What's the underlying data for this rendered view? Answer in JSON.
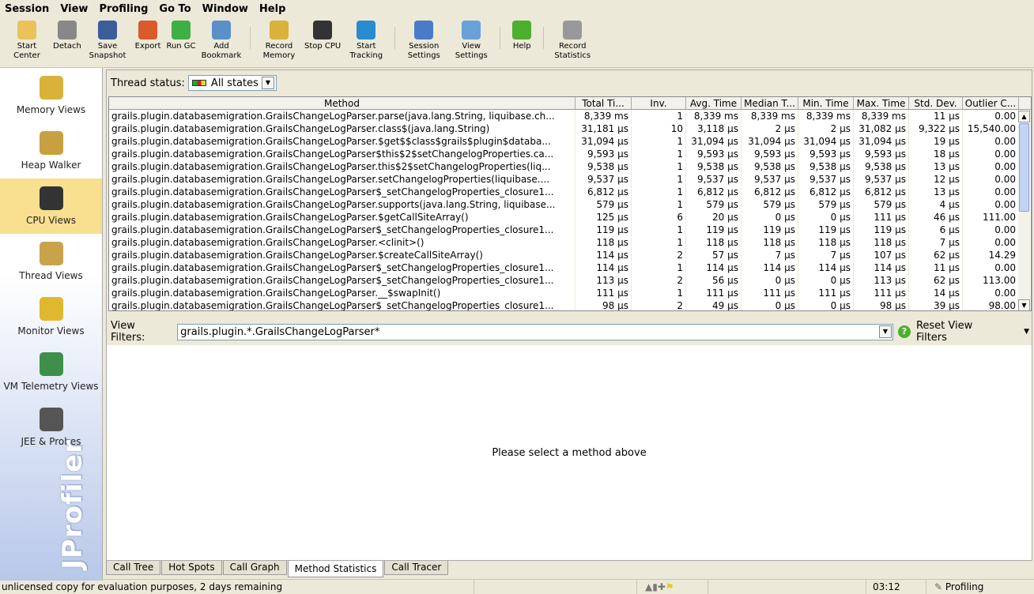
{
  "menu": [
    "Session",
    "View",
    "Profiling",
    "Go To",
    "Window",
    "Help"
  ],
  "toolbar": [
    {
      "label": "Start Center",
      "icon": "folder-gear-icon",
      "color": "#e9c25a"
    },
    {
      "label": "Detach",
      "icon": "detach-plug-icon",
      "color": "#888"
    },
    {
      "label": "Save Snapshot",
      "icon": "floppy-disk-icon",
      "color": "#3a5e9a"
    },
    {
      "label": "Export",
      "icon": "export-arrow-icon",
      "color": "#d95a2b"
    },
    {
      "label": "Run GC",
      "icon": "recycle-icon",
      "color": "#3cb043"
    },
    {
      "label": "Add Bookmark",
      "icon": "bookmark-add-icon",
      "color": "#5b8fc9"
    },
    {
      "label": "Record Memory",
      "icon": "record-memory-icon",
      "color": "#d8b23a"
    },
    {
      "label": "Stop CPU",
      "icon": "stop-cpu-icon",
      "color": "#333"
    },
    {
      "label": "Start Tracking",
      "icon": "start-tracking-icon",
      "color": "#2a8bd0"
    },
    {
      "label": "Session Settings",
      "icon": "clipboard-settings-icon",
      "color": "#4a7bc8"
    },
    {
      "label": "View Settings",
      "icon": "view-settings-icon",
      "color": "#6aa0d8"
    },
    {
      "label": "Help",
      "icon": "help-icon",
      "color": "#4caf2e"
    },
    {
      "label": "Record Statistics",
      "icon": "stopwatch-record-icon",
      "color": "#999"
    }
  ],
  "sidebar": [
    {
      "label": "Memory Views",
      "icon": "memory-blocks-icon",
      "color": "#d8b23a"
    },
    {
      "label": "Heap Walker",
      "icon": "heap-walker-icon",
      "color": "#c8a040"
    },
    {
      "label": "CPU Views",
      "icon": "cpu-chip-icon",
      "color": "#333",
      "selected": true
    },
    {
      "label": "Thread Views",
      "icon": "thread-spool-icon",
      "color": "#c9a34a"
    },
    {
      "label": "Monitor Views",
      "icon": "padlock-icon",
      "color": "#e0b830"
    },
    {
      "label": "VM Telemetry Views",
      "icon": "telemetry-chart-icon",
      "color": "#3d8f4a"
    },
    {
      "label": "JEE & Probes",
      "icon": "probe-gauge-icon",
      "color": "#555"
    }
  ],
  "brand": "JProfiler",
  "thread_status": {
    "label": "Thread status:",
    "value": "All states"
  },
  "table": {
    "columns": [
      "Method",
      "Total Ti...",
      "Inv.",
      "Avg. Time",
      "Median T...",
      "Min. Time",
      "Max. Time",
      "Std. Dev.",
      "Outlier C..."
    ],
    "rows": [
      [
        "grails.plugin.databasemigration.GrailsChangeLogParser.parse(java.lang.String, liquibase.ch...",
        "8,339 ms",
        "1",
        "8,339 ms",
        "8,339 ms",
        "8,339 ms",
        "8,339 ms",
        "11 µs",
        "0.00"
      ],
      [
        "grails.plugin.databasemigration.GrailsChangeLogParser.class$(java.lang.String)",
        "31,181 µs",
        "10",
        "3,118 µs",
        "2 µs",
        "2 µs",
        "31,082 µs",
        "9,322 µs",
        "15,540.00"
      ],
      [
        "grails.plugin.databasemigration.GrailsChangeLogParser.$get$$class$grails$plugin$databa...",
        "31,094 µs",
        "1",
        "31,094 µs",
        "31,094 µs",
        "31,094 µs",
        "31,094 µs",
        "19 µs",
        "0.00"
      ],
      [
        "grails.plugin.databasemigration.GrailsChangeLogParser$this$2$setChangelogProperties.ca...",
        "9,593 µs",
        "1",
        "9,593 µs",
        "9,593 µs",
        "9,593 µs",
        "9,593 µs",
        "18 µs",
        "0.00"
      ],
      [
        "grails.plugin.databasemigration.GrailsChangeLogParser.this$2$setChangelogProperties(liq...",
        "9,538 µs",
        "1",
        "9,538 µs",
        "9,538 µs",
        "9,538 µs",
        "9,538 µs",
        "13 µs",
        "0.00"
      ],
      [
        "grails.plugin.databasemigration.GrailsChangeLogParser.setChangelogProperties(liquibase....",
        "9,537 µs",
        "1",
        "9,537 µs",
        "9,537 µs",
        "9,537 µs",
        "9,537 µs",
        "12 µs",
        "0.00"
      ],
      [
        "grails.plugin.databasemigration.GrailsChangeLogParser$_setChangelogProperties_closure1...",
        "6,812 µs",
        "1",
        "6,812 µs",
        "6,812 µs",
        "6,812 µs",
        "6,812 µs",
        "13 µs",
        "0.00"
      ],
      [
        "grails.plugin.databasemigration.GrailsChangeLogParser.supports(java.lang.String, liquibase...",
        "579 µs",
        "1",
        "579 µs",
        "579 µs",
        "579 µs",
        "579 µs",
        "4 µs",
        "0.00"
      ],
      [
        "grails.plugin.databasemigration.GrailsChangeLogParser.$getCallSiteArray()",
        "125 µs",
        "6",
        "20 µs",
        "0 µs",
        "0 µs",
        "111 µs",
        "46 µs",
        "111.00"
      ],
      [
        "grails.plugin.databasemigration.GrailsChangeLogParser$_setChangelogProperties_closure1...",
        "119 µs",
        "1",
        "119 µs",
        "119 µs",
        "119 µs",
        "119 µs",
        "6 µs",
        "0.00"
      ],
      [
        "grails.plugin.databasemigration.GrailsChangeLogParser.<clinit>()",
        "118 µs",
        "1",
        "118 µs",
        "118 µs",
        "118 µs",
        "118 µs",
        "7 µs",
        "0.00"
      ],
      [
        "grails.plugin.databasemigration.GrailsChangeLogParser.$createCallSiteArray()",
        "114 µs",
        "2",
        "57 µs",
        "7 µs",
        "7 µs",
        "107 µs",
        "62 µs",
        "14.29"
      ],
      [
        "grails.plugin.databasemigration.GrailsChangeLogParser$_setChangelogProperties_closure1...",
        "114 µs",
        "1",
        "114 µs",
        "114 µs",
        "114 µs",
        "114 µs",
        "11 µs",
        "0.00"
      ],
      [
        "grails.plugin.databasemigration.GrailsChangeLogParser$_setChangelogProperties_closure1...",
        "113 µs",
        "2",
        "56 µs",
        "0 µs",
        "0 µs",
        "113 µs",
        "62 µs",
        "113.00"
      ],
      [
        "grails.plugin.databasemigration.GrailsChangeLogParser.__$swapInit()",
        "111 µs",
        "1",
        "111 µs",
        "111 µs",
        "111 µs",
        "111 µs",
        "14 µs",
        "0.00"
      ],
      [
        "grails.plugin.databasemigration.GrailsChangeLogParser$_setChangelogProperties_closure1...",
        "98 µs",
        "2",
        "49 µs",
        "0 µs",
        "0 µs",
        "98 µs",
        "39 µs",
        "98.00"
      ]
    ]
  },
  "filters": {
    "label": "View Filters:",
    "value": "grails.plugin.*.GrailsChangeLogParser*",
    "reset": "Reset View Filters"
  },
  "detail_message": "Please select a method above",
  "tabs": [
    {
      "label": "Call Tree"
    },
    {
      "label": "Hot Spots"
    },
    {
      "label": "Call Graph"
    },
    {
      "label": "Method Statistics",
      "active": true
    },
    {
      "label": "Call Tracer"
    }
  ],
  "status": {
    "license": "unlicensed copy for evaluation purposes, 2 days remaining",
    "time": "03:12",
    "mode": "Profiling"
  }
}
